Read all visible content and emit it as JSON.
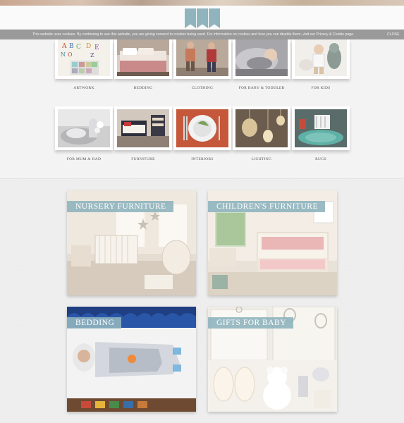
{
  "cookie_bar": {
    "text": "This website uses cookies. By continuing to use this website, you are giving consent to cookies being used. For information on cookies and how you can disable them, visit our Privacy & Cookie page.",
    "close_label": "CLOSE"
  },
  "categories": [
    {
      "label": "ARTWORK",
      "icon": "artwork-image"
    },
    {
      "label": "BEDDING",
      "icon": "bedding-image"
    },
    {
      "label": "CLOTHING",
      "icon": "clothing-image"
    },
    {
      "label": "FOR BABY & TODDLER",
      "icon": "baby-toddler-image"
    },
    {
      "label": "FOR KIDS",
      "icon": "kids-image"
    },
    {
      "label": "FOR MUM & DAD",
      "icon": "mum-dad-image"
    },
    {
      "label": "FURNITURE",
      "icon": "furniture-image"
    },
    {
      "label": "INTERIORS",
      "icon": "interiors-image"
    },
    {
      "label": "LIGHTING",
      "icon": "lighting-image"
    },
    {
      "label": "RUGS",
      "icon": "rugs-image"
    }
  ],
  "features": [
    {
      "title": "NURSERY FURNITURE"
    },
    {
      "title": "CHILDREN'S FURNITURE"
    },
    {
      "title": "BEDDING"
    },
    {
      "title": "GIFTS FOR BABY"
    }
  ],
  "colors": {
    "accent": "#8fb4be",
    "cookie_bar": "#9a9a9a",
    "background": "#f2f2f2"
  }
}
